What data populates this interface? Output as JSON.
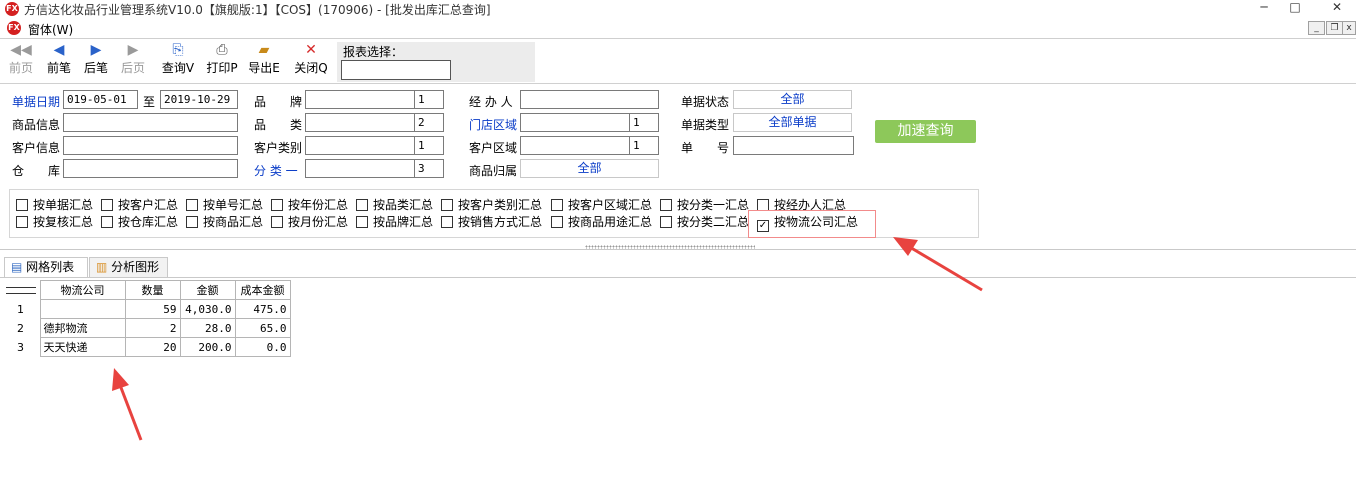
{
  "window": {
    "title": "方信达化妆品行业管理系统V10.0【旗舰版:1】【COS】(170906) - [批发出库汇总查询]",
    "logo_text": "FX",
    "menu_window": "窗体(W)",
    "controls": {
      "minimize": "─",
      "maximize": "□",
      "close": "✕"
    },
    "mdi_controls": {
      "minimize": "_",
      "restore": "❐",
      "close": "x"
    }
  },
  "toolbar": {
    "first": "前页",
    "prev": "前笔",
    "next": "后笔",
    "last": "后页",
    "query": "查询V",
    "print": "打印P",
    "export": "导出E",
    "close": "关闭Q",
    "report_label": "报表选择："
  },
  "filters": {
    "date_label": "单据日期",
    "date_from": "019-05-01",
    "date_to_label": "至",
    "date_to": "2019-10-29",
    "brand_label": "品　　牌",
    "brand_level": "1",
    "handler_label": "经 办 人",
    "status_label": "单据状态",
    "status_value": "全部",
    "product_label": "商品信息",
    "category_label": "品　　类",
    "category_level": "2",
    "store_region_label": "门店区域",
    "store_region_level": "1",
    "doc_type_label": "单据类型",
    "doc_type_value": "全部单据",
    "customer_label": "客户信息",
    "cust_type_label": "客户类别",
    "cust_type_level": "1",
    "cust_region_label": "客户区域",
    "cust_region_level": "1",
    "doc_no_label": "单　　号",
    "warehouse_label": "仓　　库",
    "class1_label": "分 类 一",
    "class1_level": "3",
    "product_owner_label": "商品归属",
    "product_owner_value": "全部",
    "quick_query": "加速查询"
  },
  "summary_options": {
    "row1": [
      "按单据汇总",
      "按客户汇总",
      "按单号汇总",
      "按年份汇总",
      "按品类汇总",
      "按客户类别汇总",
      "按客户区域汇总",
      "按分类一汇总",
      "按经办人汇总"
    ],
    "row2": [
      "按复核汇总",
      "按仓库汇总",
      "按商品汇总",
      "按月份汇总",
      "按品牌汇总",
      "按销售方式汇总",
      "按商品用途汇总",
      "按分类二汇总",
      "按物流公司汇总"
    ],
    "checked": "按物流公司汇总",
    "check_mark": "✓"
  },
  "tabs": {
    "grid": "网格列表",
    "chart": "分析图形"
  },
  "grid": {
    "headers": [
      "物流公司",
      "数量",
      "金额",
      "成本金额"
    ],
    "rows": [
      {
        "no": "1",
        "company": "",
        "qty": "59",
        "amount": "4,030.0",
        "cost": "475.0"
      },
      {
        "no": "2",
        "company": "德邦物流",
        "qty": "2",
        "amount": "28.0",
        "cost": "65.0"
      },
      {
        "no": "3",
        "company": "天天快递",
        "qty": "20",
        "amount": "200.0",
        "cost": "0.0"
      }
    ]
  },
  "colors": {
    "accent_blue": "#0a3cc8",
    "quick_button": "#8dc85a",
    "annotation_red": "#e8433f"
  }
}
